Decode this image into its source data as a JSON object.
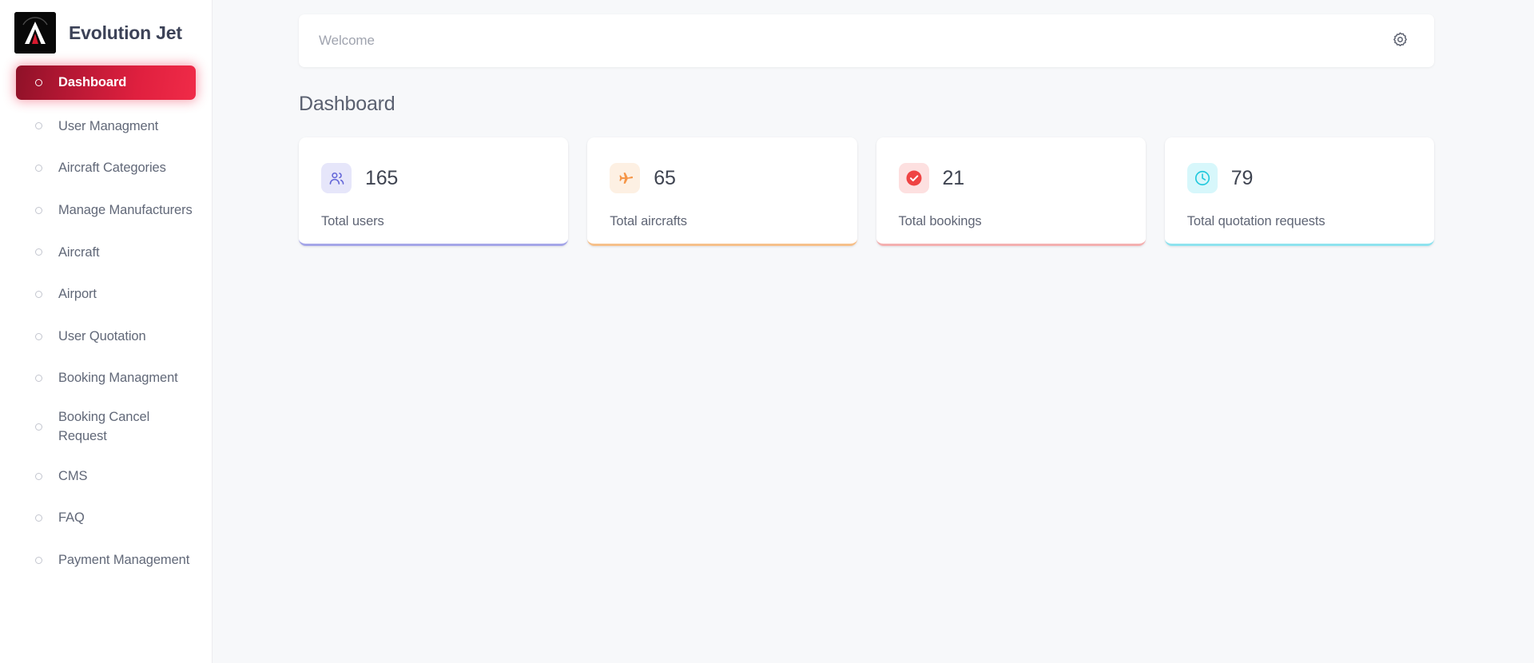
{
  "brand": {
    "name": "Evolution Jet",
    "logo_icon": "evolution-jet-logo"
  },
  "sidebar": {
    "items": [
      {
        "label": "Dashboard",
        "active": true
      },
      {
        "label": "User Managment",
        "active": false
      },
      {
        "label": "Aircraft Categories",
        "active": false
      },
      {
        "label": "Manage Manufacturers",
        "active": false
      },
      {
        "label": "Aircraft",
        "active": false
      },
      {
        "label": "Airport",
        "active": false
      },
      {
        "label": "User Quotation",
        "active": false
      },
      {
        "label": "Booking Managment",
        "active": false
      },
      {
        "label": "Booking Cancel Request",
        "active": false,
        "two_line": true
      },
      {
        "label": "CMS",
        "active": false
      },
      {
        "label": "FAQ",
        "active": false
      },
      {
        "label": "Payment Management",
        "active": false
      }
    ]
  },
  "topbar": {
    "welcome_text": "Welcome",
    "settings_icon": "gear-icon"
  },
  "main": {
    "page_title": "Dashboard",
    "cards": [
      {
        "value": "165",
        "label": "Total users",
        "icon": "users-icon",
        "icon_color": "#6366d8",
        "icon_bg": "#e6e6fa",
        "accent": "#a5a6e8"
      },
      {
        "value": "65",
        "label": "Total aircrafts",
        "icon": "airplane-icon",
        "icon_color": "#f59547",
        "icon_bg": "#fdf0e3",
        "accent": "#f6c08a"
      },
      {
        "value": "21",
        "label": "Total bookings",
        "icon": "check-circle-icon",
        "icon_color": "#ef4444",
        "icon_bg": "#fde0e0",
        "accent": "#f4b0b0"
      },
      {
        "value": "79",
        "label": "Total quotation requests",
        "icon": "clock-icon",
        "icon_color": "#22c9dd",
        "icon_bg": "#d7f7fb",
        "accent": "#8fe3ef"
      }
    ]
  },
  "colors": {
    "active_nav_start": "#8e1128",
    "active_nav_end": "#f02b48",
    "canvas": "#f7f8fa",
    "sidebar_bg": "#ffffff"
  }
}
